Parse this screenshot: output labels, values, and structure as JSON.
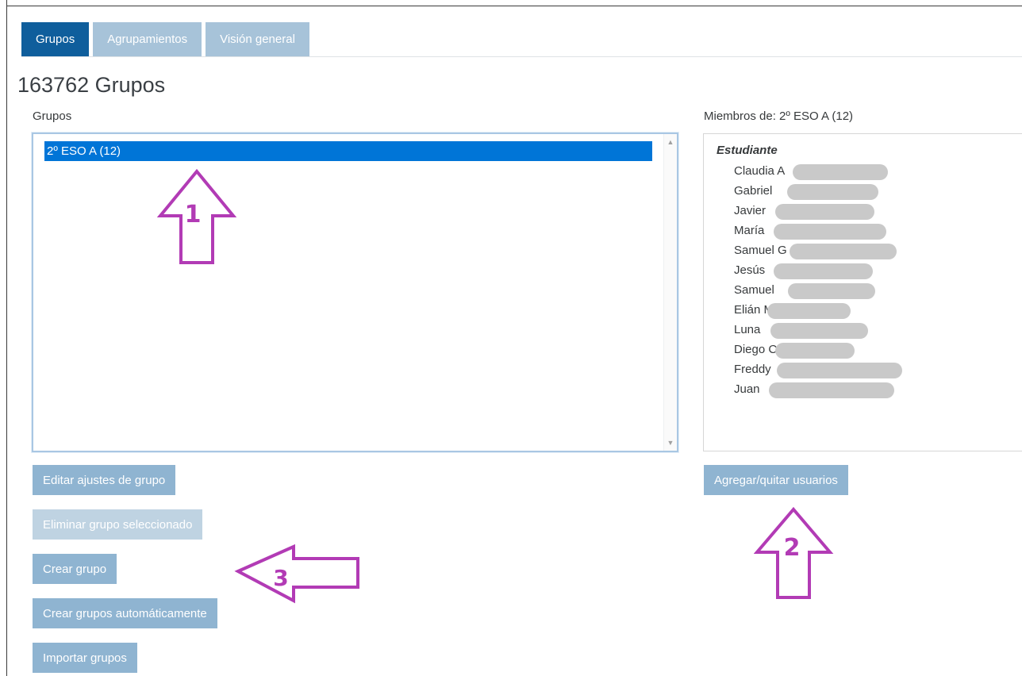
{
  "tabs": [
    {
      "label": "Grupos",
      "active": true
    },
    {
      "label": "Agrupamientos",
      "active": false
    },
    {
      "label": "Visión general",
      "active": false
    }
  ],
  "page_title": "163762 Grupos",
  "groups_panel": {
    "label": "Grupos",
    "options": [
      {
        "label": "2º ESO A (12)",
        "selected": true
      }
    ]
  },
  "members_panel": {
    "label": "Miembros de: 2º ESO A (12)",
    "role": "Estudiante",
    "members": [
      "Claudia A",
      "Gabriel",
      "Javier",
      "María",
      "Samuel G",
      "Jesús",
      "Samuel",
      "Elián M",
      "Luna",
      "Diego C",
      "Freddy",
      "Juan"
    ]
  },
  "buttons": {
    "edit_group": "Editar ajustes de grupo",
    "delete_group": "Eliminar grupo seleccionado",
    "create_group": "Crear grupo",
    "auto_create": "Crear grupos automáticamente",
    "import_groups": "Importar grupos",
    "add_remove_users": "Agregar/quitar usuarios"
  },
  "annotations": {
    "arrow_1": "1",
    "arrow_2": "2",
    "arrow_3": "3",
    "color": "#b23bb5"
  },
  "colors": {
    "tab_active": "#0f5e9c",
    "tab_inactive": "#a7c3d9",
    "button": "#8fb4d1",
    "selection": "#0075d7"
  }
}
